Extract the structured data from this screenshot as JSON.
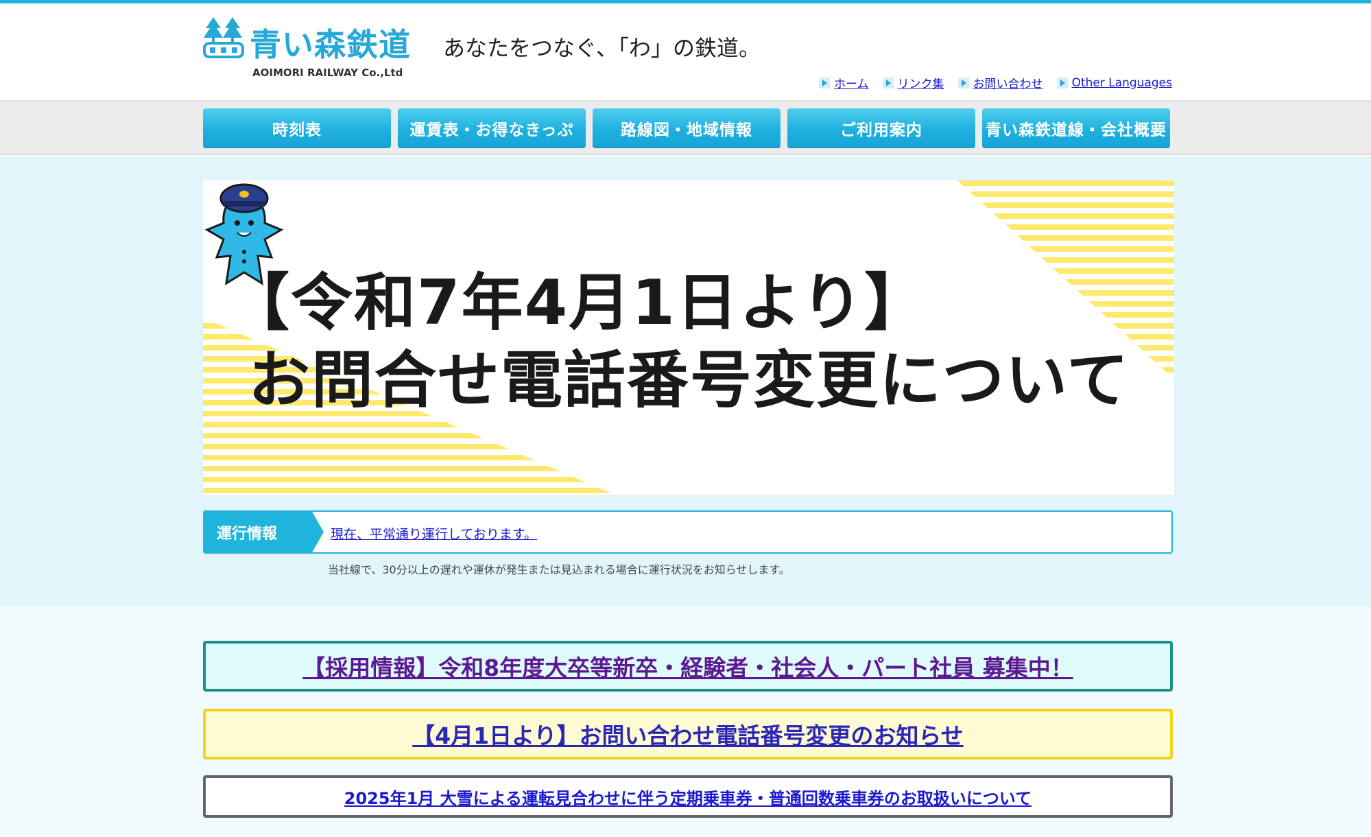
{
  "header": {
    "logo_title": "青い森鉄道",
    "logo_subtitle": "AOIMORI RAILWAY Co.,Ltd",
    "tagline": "あなたをつなぐ、「わ」の鉄道。",
    "util_links": [
      "ホーム",
      "リンク集",
      "お問い合わせ",
      "Other Languages"
    ]
  },
  "nav": {
    "items": [
      "時刻表",
      "運賃表・お得なきっぷ",
      "路線図・地域情報",
      "ご利用案内",
      "青い森鉄道線・会社概要"
    ]
  },
  "banner": {
    "line1": "【令和7年4月1日より】",
    "line2": "お問合せ電話番号変更について"
  },
  "status": {
    "label": "運行情報",
    "text": "現在、平常通り運行しております。",
    "note": "当社線で、30分以上の遅れや運休が発生または見込まれる場合に運行状況をお知らせします。"
  },
  "notices": [
    "【採用情報】令和8年度大卒等新卒・経験者・社会人・パート社員 募集中！",
    "【4月1日より】お問い合わせ電話番号変更のお知らせ",
    "2025年1月 大雪による運転見合わせに伴う定期乗車券・普通回数乗車券のお取扱いについて"
  ],
  "colors": {
    "accent": "#1fb4dc",
    "link": "#1a1ad0",
    "stripe_yellow": "#fdea6c",
    "notice_teal": "#1d8f8a",
    "notice_yellow": "#f3d21a"
  },
  "icons": [
    "tree-station-logo-icon",
    "arrow-bullet-icon",
    "mascot-illustration"
  ]
}
